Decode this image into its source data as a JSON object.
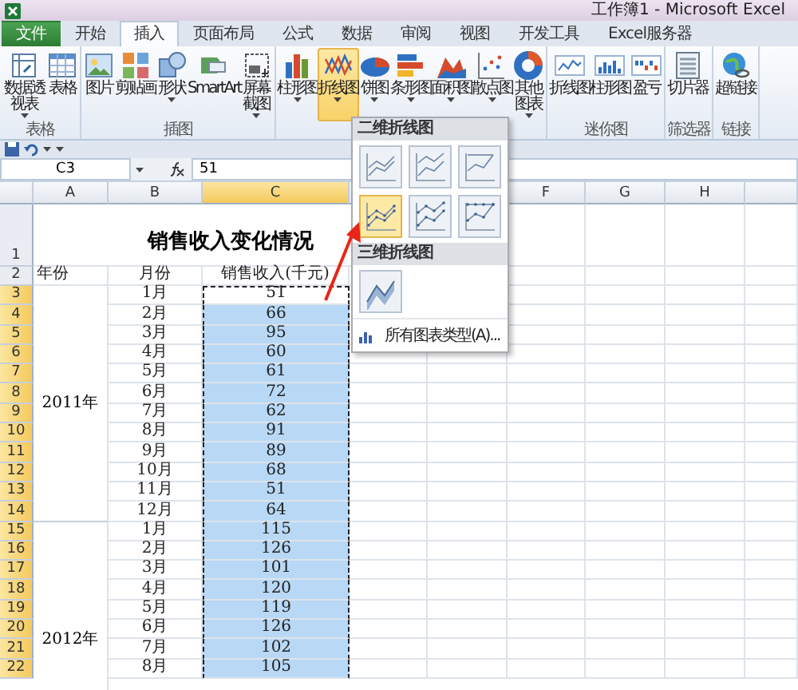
{
  "window": {
    "title": "工作簿1 - Microsoft Excel"
  },
  "tabs": [
    {
      "label": "文件",
      "kind": "file",
      "selected": false
    },
    {
      "label": "开始",
      "kind": "tab",
      "selected": false
    },
    {
      "label": "插入",
      "kind": "tab",
      "selected": true
    },
    {
      "label": "页面布局",
      "kind": "tab",
      "selected": false
    },
    {
      "label": "公式",
      "kind": "tab",
      "selected": false
    },
    {
      "label": "数据",
      "kind": "tab",
      "selected": false
    },
    {
      "label": "审阅",
      "kind": "tab",
      "selected": false
    },
    {
      "label": "视图",
      "kind": "tab",
      "selected": false
    },
    {
      "label": "开发工具",
      "kind": "tab",
      "selected": false
    },
    {
      "label": "Excel服务器",
      "kind": "tab",
      "selected": false
    }
  ],
  "ribbon": {
    "groups": [
      {
        "label": "表格",
        "buttons": [
          {
            "label": "数据透视表",
            "dropdown": true,
            "selected": false
          },
          {
            "label": "表格",
            "dropdown": false,
            "selected": false
          }
        ]
      },
      {
        "label": "插图",
        "buttons": [
          {
            "label": "图片",
            "dropdown": false,
            "selected": false
          },
          {
            "label": "剪贴画",
            "dropdown": false,
            "selected": false
          },
          {
            "label": "形状",
            "dropdown": true,
            "selected": false
          },
          {
            "label": "SmartArt",
            "dropdown": false,
            "selected": false
          },
          {
            "label": "屏幕截图",
            "dropdown": true,
            "selected": false
          }
        ]
      },
      {
        "buttons": [
          {
            "label": "柱形图",
            "dropdown": true,
            "selected": false
          },
          {
            "label": "折线图",
            "dropdown": true,
            "selected": true
          },
          {
            "label": "饼图",
            "dropdown": true,
            "selected": false
          },
          {
            "label": "条形图",
            "dropdown": true,
            "selected": false
          },
          {
            "label": "面积图",
            "dropdown": true,
            "selected": false
          },
          {
            "label": "散点图",
            "dropdown": true,
            "selected": false
          },
          {
            "label": "其他图表",
            "dropdown": true,
            "selected": false
          }
        ]
      },
      {
        "label": "迷你图",
        "buttons": [
          {
            "label": "折线图",
            "dropdown": false,
            "selected": false
          },
          {
            "label": "柱形图",
            "dropdown": false,
            "selected": false
          },
          {
            "label": "盈亏",
            "dropdown": false,
            "selected": false
          }
        ]
      },
      {
        "label": "筛选器",
        "buttons": [
          {
            "label": "切片器",
            "dropdown": false,
            "selected": false
          }
        ]
      },
      {
        "label": "链接",
        "buttons": [
          {
            "label": "超链接",
            "dropdown": false,
            "selected": false
          }
        ]
      }
    ]
  },
  "formula_bar": {
    "name_box": "C3",
    "formula": "51"
  },
  "line_menu": {
    "sections": [
      {
        "header": "二维折线图",
        "items": [
          {
            "selected": false
          },
          {
            "selected": false
          },
          {
            "selected": false
          },
          {
            "selected": true
          },
          {
            "selected": false
          },
          {
            "selected": false
          }
        ]
      },
      {
        "header": "三维折线图",
        "items": [
          {
            "selected": false
          }
        ]
      }
    ],
    "footer": "所有图表类型(A)..."
  },
  "sheet": {
    "columns": [
      {
        "label": "A",
        "selected": false
      },
      {
        "label": "B",
        "selected": false
      },
      {
        "label": "C",
        "selected": true
      },
      {
        "label": "F",
        "selected": false
      },
      {
        "label": "G",
        "selected": false
      },
      {
        "label": "H",
        "selected": false
      }
    ],
    "title_row": {
      "number": "1",
      "title": "销售收入变化情况"
    },
    "header_row": {
      "number": "2",
      "year": "年份",
      "month": "月份",
      "value": "销售收入(千元)"
    },
    "years": [
      {
        "label": "2011年",
        "rows": [
          {
            "number": "3",
            "month": "1月",
            "value": "51",
            "selected": true,
            "active": true
          },
          {
            "number": "4",
            "month": "2月",
            "value": "66",
            "selected": true,
            "active": false
          },
          {
            "number": "5",
            "month": "3月",
            "value": "95",
            "selected": true,
            "active": false
          },
          {
            "number": "6",
            "month": "4月",
            "value": "60",
            "selected": true,
            "active": false
          },
          {
            "number": "7",
            "month": "5月",
            "value": "61",
            "selected": true,
            "active": false
          },
          {
            "number": "8",
            "month": "6月",
            "value": "72",
            "selected": true,
            "active": false
          },
          {
            "number": "9",
            "month": "7月",
            "value": "62",
            "selected": true,
            "active": false
          },
          {
            "number": "10",
            "month": "8月",
            "value": "91",
            "selected": true,
            "active": false
          },
          {
            "number": "11",
            "month": "9月",
            "value": "89",
            "selected": true,
            "active": false
          },
          {
            "number": "12",
            "month": "10月",
            "value": "68",
            "selected": true,
            "active": false
          },
          {
            "number": "13",
            "month": "11月",
            "value": "51",
            "selected": true,
            "active": false
          },
          {
            "number": "14",
            "month": "12月",
            "value": "64",
            "selected": true,
            "active": false
          }
        ]
      },
      {
        "label": "2012年",
        "rows": [
          {
            "number": "15",
            "month": "1月",
            "value": "115",
            "selected": true,
            "active": false
          },
          {
            "number": "16",
            "month": "2月",
            "value": "126",
            "selected": true,
            "active": false
          },
          {
            "number": "17",
            "month": "3月",
            "value": "101",
            "selected": true,
            "active": false
          },
          {
            "number": "18",
            "month": "4月",
            "value": "120",
            "selected": true,
            "active": false
          },
          {
            "number": "19",
            "month": "5月",
            "value": "119",
            "selected": true,
            "active": false
          },
          {
            "number": "20",
            "month": "6月",
            "value": "126",
            "selected": true,
            "active": false
          },
          {
            "number": "21",
            "month": "7月",
            "value": "102",
            "selected": true,
            "active": false
          },
          {
            "number": "22",
            "month": "8月",
            "value": "105",
            "selected": true,
            "active": false
          }
        ]
      }
    ]
  }
}
